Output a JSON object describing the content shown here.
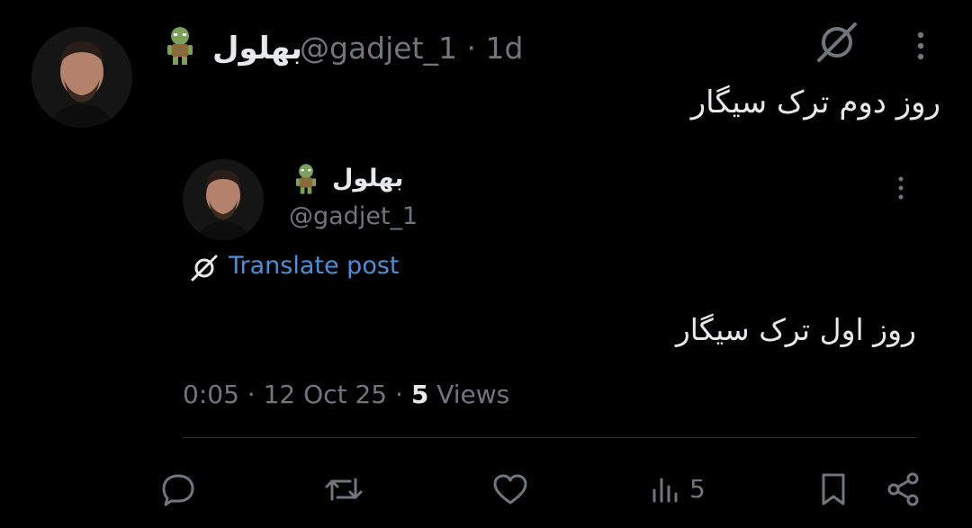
{
  "post": {
    "author_name": "بهلول",
    "handle": "@gadjet_1",
    "separator": "·",
    "age": "1d",
    "text": "روز دوم ترک سیگار"
  },
  "quote": {
    "author_name": "بهلول",
    "handle": "@gadjet_1",
    "translate_label": "Translate post",
    "text": "روز اول ترک سیگار",
    "time": "0:05",
    "date": "12 Oct 25",
    "sep": "·",
    "views_count": "5",
    "views_label": "Views"
  },
  "actions": {
    "views_count": "5"
  },
  "colors": {
    "background": "#000000",
    "text": "#e7e9ea",
    "muted": "#71767b",
    "link": "#4a90d9"
  },
  "icons": [
    "troll-emoji",
    "grok-icon",
    "more-icon",
    "translate-icon",
    "reply-icon",
    "repost-icon",
    "like-icon",
    "views-icon",
    "bookmark-icon",
    "share-icon"
  ]
}
